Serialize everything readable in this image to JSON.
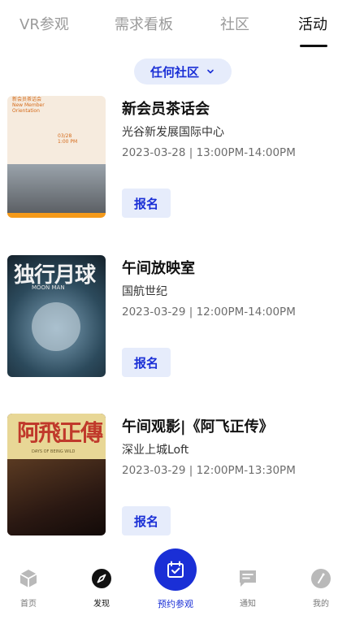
{
  "tabs": [
    {
      "label": "VR参观"
    },
    {
      "label": "需求看板"
    },
    {
      "label": "社区"
    },
    {
      "label": "活动"
    }
  ],
  "filter": {
    "label": "任何社区"
  },
  "events": [
    {
      "title": "新会员茶话会",
      "place": "光谷新发展国际中心",
      "time": "2023-03-28 | 13:00PM-14:00PM",
      "button": "报名",
      "thumb_lines": [
        "新会员茶话会",
        "New Member",
        "Orientation",
        "03/28",
        "1:00 PM"
      ]
    },
    {
      "title": "午间放映室",
      "place": "国航世纪",
      "time": "2023-03-29 | 12:00PM-14:00PM",
      "button": "报名",
      "thumb_title": "独行月球",
      "thumb_sub": "MOON MAN"
    },
    {
      "title": "午间观影|《阿飞正传》",
      "place": "深业上城Loft",
      "time": "2023-03-29 | 12:00PM-13:30PM",
      "button": "报名",
      "thumb_title": "阿飛正傳",
      "thumb_sub": "DAYS OF BEING WILD"
    }
  ],
  "nav": {
    "home": "首页",
    "discover": "发现",
    "center": "预约参观",
    "notify": "通知",
    "mine": "我的"
  },
  "colors": {
    "accent": "#1a2fd6",
    "pill_bg": "#e6ecfb",
    "text_muted": "#6d6d6d"
  }
}
